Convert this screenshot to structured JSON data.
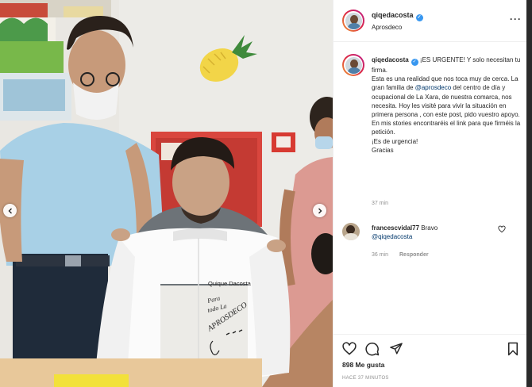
{
  "post": {
    "username": "qiqedacosta",
    "location": "Aprosdeco"
  },
  "caption": {
    "username": "qiqedacosta",
    "intro": "¡ES URGENTE! Y solo necesitan tu firma.",
    "line1": "Esta es una realidad que nos toca muy de cerca. La gran familia de ",
    "mention": "@aprosdeco",
    "line2": " del centro de día y ocupacional de La Xara, de nuestra comarca, nos necesita. Hoy les visité para vivir la situación en primera persona , con este post, pido vuestro apoyo. En mis stories encontraréis el link para que firméis la petición.",
    "line3": "¡Es de urgencia!",
    "line4": "Gracias",
    "time": "37 min"
  },
  "comment": {
    "username": "francescvidal77",
    "text": "Bravo",
    "mention": "@qiqedacosta",
    "time": "36 min",
    "reply_label": "Responder"
  },
  "stats": {
    "likes": "898 Me gusta",
    "posted": "HACE 37 MINUTOS"
  },
  "photo": {
    "jacket_brand": "Quique Dacosta",
    "jacket_handwriting_1": "Para",
    "jacket_handwriting_2": "todo La",
    "jacket_handwriting_3": "APROSDECO"
  },
  "icons": {
    "prev": "chevron-left-icon",
    "next": "chevron-right-icon",
    "like": "heart-icon",
    "comment": "comment-icon",
    "share": "paper-plane-icon",
    "save": "bookmark-icon",
    "more": "more-dots-icon"
  },
  "colors": {
    "verified": "#3897f0",
    "mention": "#00376b",
    "muted": "#8e8e8e"
  }
}
